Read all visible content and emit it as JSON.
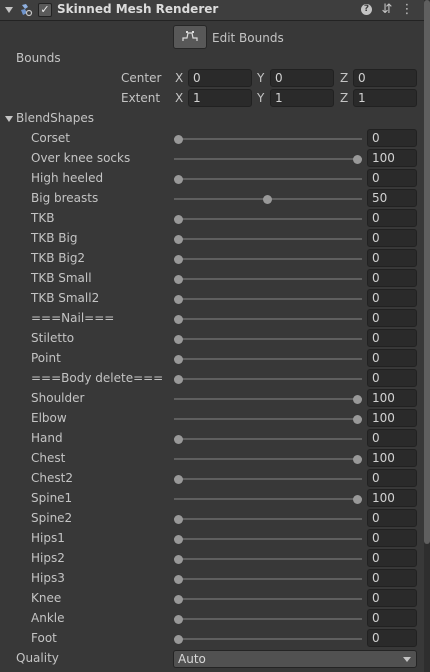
{
  "component": {
    "title": "Skinned Mesh Renderer",
    "enabled": true,
    "icons": [
      "fold-arrow-icon",
      "mesh-renderer-icon",
      "checkbox-icon",
      "help-icon",
      "preset-icon",
      "more-options-icon"
    ]
  },
  "edit_bounds": {
    "label": "Edit Bounds"
  },
  "bounds": {
    "label": "Bounds",
    "center": {
      "label": "Center",
      "x": "0",
      "y": "0",
      "z": "0"
    },
    "extent": {
      "label": "Extent",
      "x": "1",
      "y": "1",
      "z": "1"
    },
    "axis": {
      "x": "X",
      "y": "Y",
      "z": "Z"
    }
  },
  "blendshapes": {
    "label": "BlendShapes",
    "items": [
      {
        "name": "Corset",
        "value": "0"
      },
      {
        "name": "Over knee socks",
        "value": "100"
      },
      {
        "name": "High heeled",
        "value": "0"
      },
      {
        "name": "Big breasts",
        "value": "50"
      },
      {
        "name": "TKB",
        "value": "0"
      },
      {
        "name": "TKB Big",
        "value": "0"
      },
      {
        "name": "TKB Big2",
        "value": "0"
      },
      {
        "name": "TKB Small",
        "value": "0"
      },
      {
        "name": "TKB Small2",
        "value": "0"
      },
      {
        "name": "===Nail===",
        "value": "0"
      },
      {
        "name": "Stiletto",
        "value": "0"
      },
      {
        "name": "Point",
        "value": "0"
      },
      {
        "name": "===Body delete===",
        "value": "0"
      },
      {
        "name": "Shoulder",
        "value": "100"
      },
      {
        "name": "Elbow",
        "value": "100"
      },
      {
        "name": "Hand",
        "value": "0"
      },
      {
        "name": "Chest",
        "value": "100"
      },
      {
        "name": "Chest2",
        "value": "0"
      },
      {
        "name": "Spine1",
        "value": "100"
      },
      {
        "name": "Spine2",
        "value": "0"
      },
      {
        "name": "Hips1",
        "value": "0"
      },
      {
        "name": "Hips2",
        "value": "0"
      },
      {
        "name": "Hips3",
        "value": "0"
      },
      {
        "name": "Knee",
        "value": "0"
      },
      {
        "name": "Ankle",
        "value": "0"
      },
      {
        "name": "Foot",
        "value": "0"
      }
    ]
  },
  "quality": {
    "label": "Quality",
    "value": "Auto"
  },
  "colors": {
    "panel_bg": "#383838",
    "header_bg": "#3e3e3e",
    "field_bg": "#2a2a2a",
    "text": "#c4c4c4",
    "slider_thumb": "#999999"
  }
}
